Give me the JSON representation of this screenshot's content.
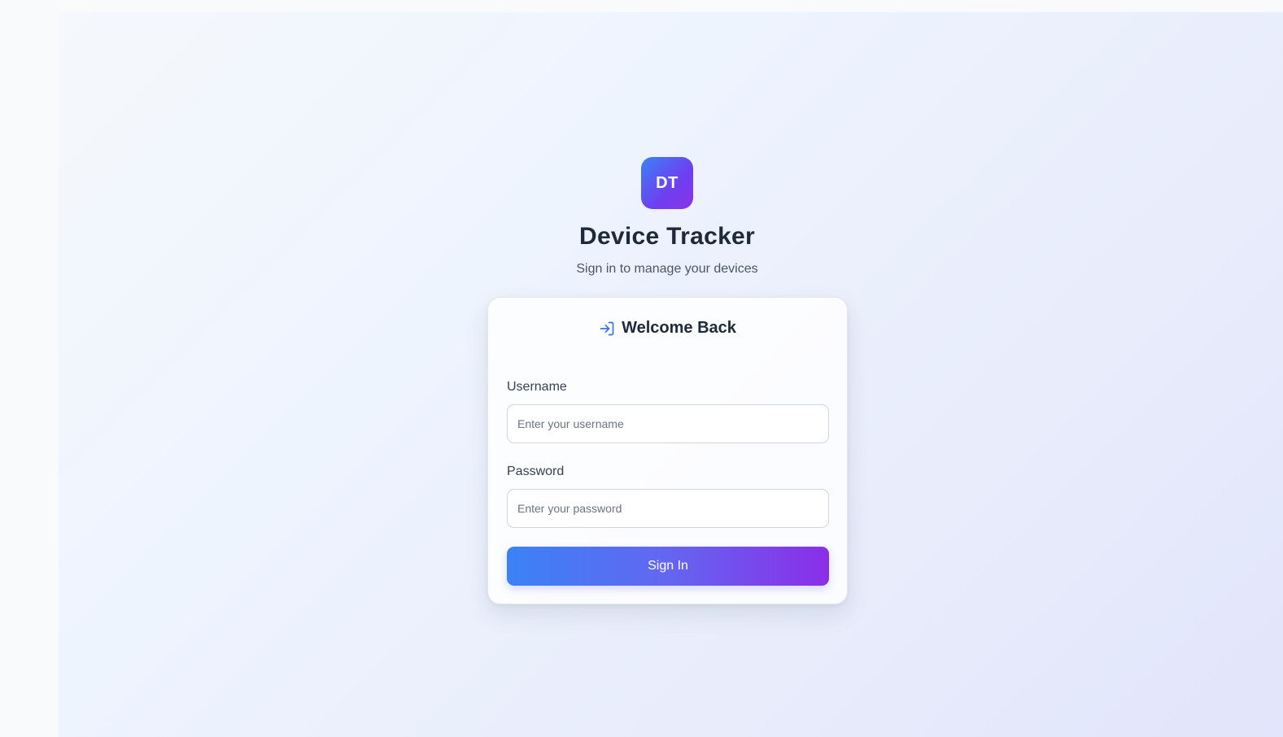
{
  "brand": {
    "logo_initials": "DT",
    "title": "Device Tracker",
    "subtitle": "Sign in to manage your devices"
  },
  "login_card": {
    "title": "Welcome Back",
    "icon": "sign-in-icon",
    "username": {
      "label": "Username",
      "placeholder": "Enter your username",
      "value": ""
    },
    "password": {
      "label": "Password",
      "placeholder": "Enter your password",
      "value": ""
    },
    "submit_label": "Sign In"
  },
  "colors": {
    "accent_blue": "#3b82f6",
    "accent_purple": "#8b2ee8",
    "heading": "#1e293b",
    "muted_text": "#4b5563"
  }
}
